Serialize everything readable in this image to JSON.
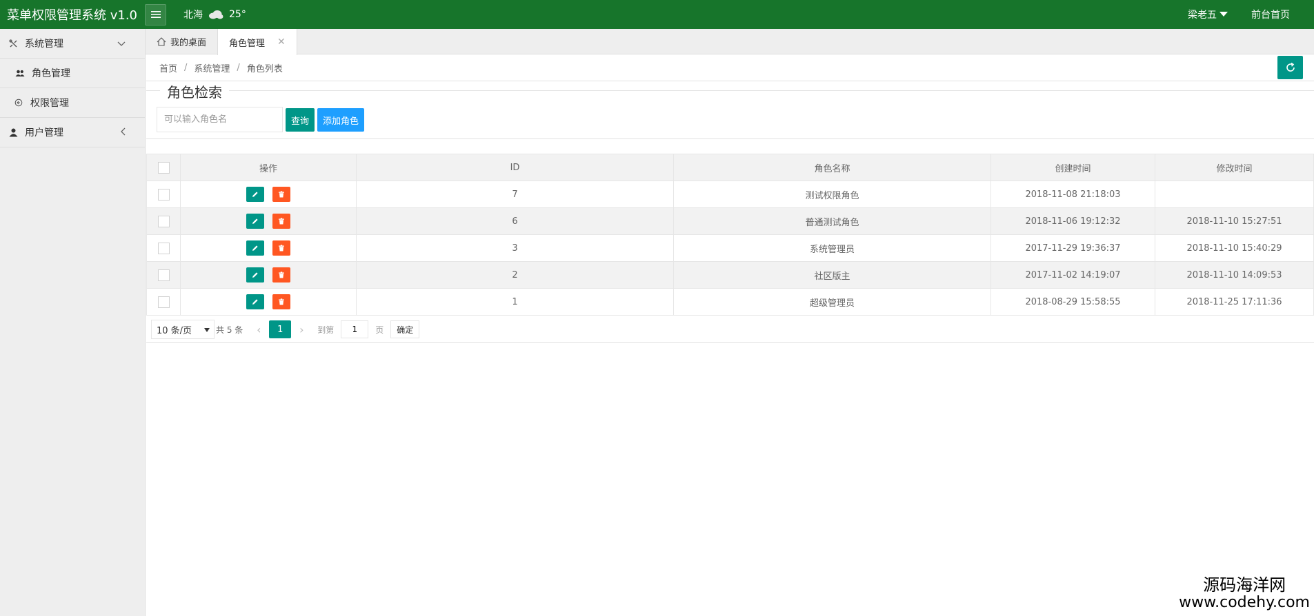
{
  "header": {
    "title": "菜单权限管理系统 v1.0",
    "weather": {
      "city": "北海",
      "temp": "25°"
    },
    "user": "梁老五",
    "home_link": "前台首页"
  },
  "sidebar": {
    "groups": [
      {
        "label": "系统管理",
        "items": [
          {
            "label": "角色管理"
          },
          {
            "label": "权限管理"
          }
        ]
      },
      {
        "label": "用户管理"
      }
    ]
  },
  "tabs": [
    {
      "label": "我的桌面"
    },
    {
      "label": "角色管理"
    }
  ],
  "breadcrumb": [
    "首页",
    "系统管理",
    "角色列表"
  ],
  "search": {
    "legend": "角色检索",
    "placeholder": "可以输入角色名",
    "query_label": "查询",
    "add_label": "添加角色"
  },
  "table": {
    "headers": [
      "操作",
      "ID",
      "角色名称",
      "创建时间",
      "修改时间"
    ],
    "rows": [
      {
        "id": "7",
        "name": "测试权限角色",
        "created": "2018-11-08 21:18:03",
        "modified": ""
      },
      {
        "id": "6",
        "name": "普通测试角色",
        "created": "2018-11-06 19:12:32",
        "modified": "2018-11-10 15:27:51"
      },
      {
        "id": "3",
        "name": "系统管理员",
        "created": "2017-11-29 19:36:37",
        "modified": "2018-11-10 15:40:29"
      },
      {
        "id": "2",
        "name": "社区版主",
        "created": "2017-11-02 14:19:07",
        "modified": "2018-11-10 14:09:53"
      },
      {
        "id": "1",
        "name": "超级管理员",
        "created": "2018-08-29 15:58:55",
        "modified": "2018-11-25 17:11:36"
      }
    ]
  },
  "pager": {
    "page_size": "10 条/页",
    "total": "共 5 条",
    "current": "1",
    "goto_label": "到第",
    "goto_value": "1",
    "page_label": "页",
    "confirm": "确定"
  },
  "watermark": {
    "cn": "源码海洋网",
    "en": "www.codehy.com"
  },
  "colors": {
    "header": "#17752b",
    "primary": "#009688",
    "blue": "#1e9fff",
    "danger": "#ff5722"
  }
}
